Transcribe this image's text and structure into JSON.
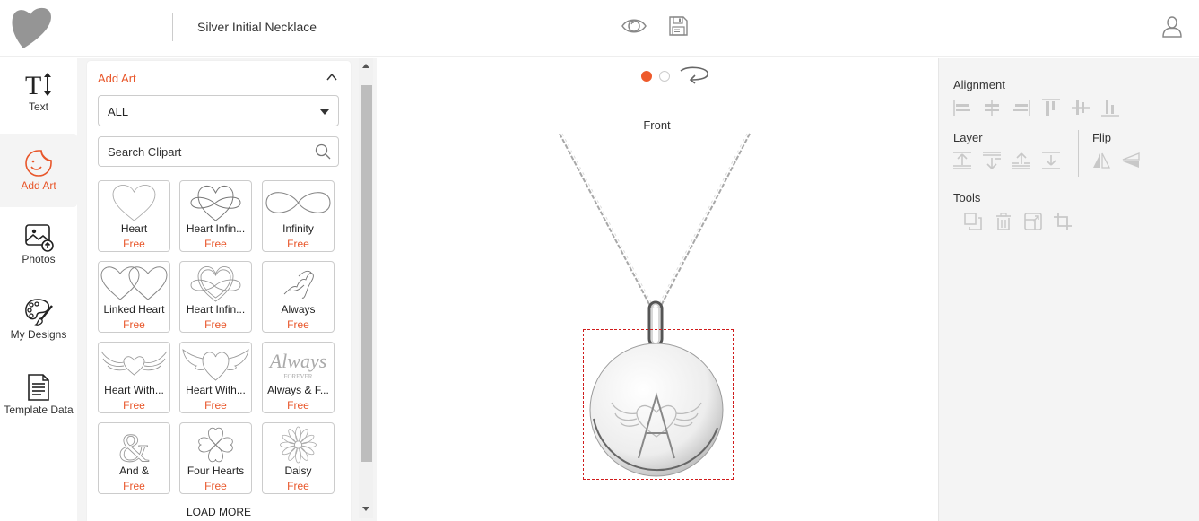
{
  "header": {
    "logo_icon": "heart-logo-icon",
    "product_title": "Silver Initial Necklace",
    "preview_icon": "eye-icon",
    "save_icon": "floppy-disk-icon",
    "user_icon": "user-account-icon"
  },
  "rail": {
    "items": [
      {
        "label": "Text",
        "icon": "text-size-icon",
        "active": false
      },
      {
        "label": "Add Art",
        "icon": "sticker-smiley-icon",
        "active": true
      },
      {
        "label": "Photos",
        "icon": "image-upload-icon",
        "active": false
      },
      {
        "label": "My Designs",
        "icon": "palette-icon",
        "active": false
      },
      {
        "label": "Template Data",
        "icon": "document-icon",
        "active": false
      }
    ]
  },
  "art_panel": {
    "title": "Add Art",
    "category_select": {
      "value": "ALL"
    },
    "search": {
      "placeholder": "Search Clipart",
      "value": ""
    },
    "items": [
      {
        "name": "Heart",
        "price": "Free"
      },
      {
        "name": "Heart Infin...",
        "price": "Free"
      },
      {
        "name": "Infinity",
        "price": "Free"
      },
      {
        "name": "Linked Heart",
        "price": "Free"
      },
      {
        "name": "Heart Infin...",
        "price": "Free"
      },
      {
        "name": "Always",
        "price": "Free"
      },
      {
        "name": "Heart With...",
        "price": "Free"
      },
      {
        "name": "Heart With...",
        "price": "Free"
      },
      {
        "name": "Always & F...",
        "price": "Free"
      },
      {
        "name": "And &",
        "price": "Free"
      },
      {
        "name": "Four Hearts",
        "price": "Free"
      },
      {
        "name": "Daisy",
        "price": "Free"
      }
    ],
    "load_more": "LOAD MORE"
  },
  "canvas": {
    "pages": [
      {
        "active": true
      },
      {
        "active": false
      }
    ],
    "rotate_icon": "rotate-view-icon",
    "side_label": "Front",
    "engraving_initial": "A"
  },
  "right_panel": {
    "alignment": {
      "title": "Alignment",
      "tools": [
        "align-left-icon",
        "align-center-horizontal-icon",
        "align-right-icon",
        "align-top-icon",
        "align-middle-vertical-icon",
        "align-bottom-icon"
      ]
    },
    "layer": {
      "title": "Layer",
      "tools": [
        "bring-to-front-icon",
        "send-to-back-icon",
        "bring-forward-icon",
        "send-backward-icon"
      ]
    },
    "flip": {
      "title": "Flip",
      "tools": [
        "flip-horizontal-icon",
        "flip-vertical-icon"
      ]
    },
    "tools": {
      "title": "Tools",
      "tools": [
        "duplicate-icon",
        "delete-icon",
        "resize-icon",
        "crop-icon"
      ]
    }
  },
  "colors": {
    "accent": "#e8562a",
    "selection": "#d01c1c",
    "panel_bg": "#f4f4f4"
  }
}
